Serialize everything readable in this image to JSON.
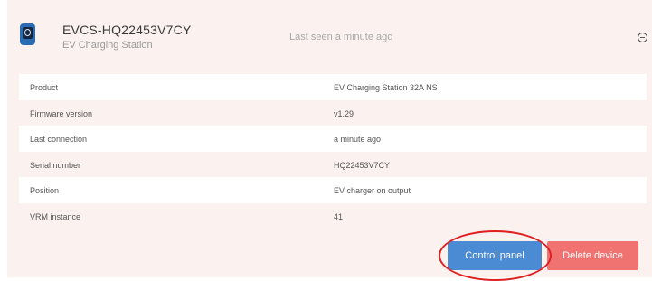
{
  "device": {
    "name": "EVCS-HQ22453V7CY",
    "type": "EV Charging Station",
    "last_seen": "Last seen a minute ago"
  },
  "details": [
    {
      "key": "Product",
      "value": "EV Charging Station 32A NS"
    },
    {
      "key": "Firmware version",
      "value": "v1.29"
    },
    {
      "key": "Last connection",
      "value": "a minute ago"
    },
    {
      "key": "Serial number",
      "value": "HQ22453V7CY"
    },
    {
      "key": "Position",
      "value": "EV charger on output"
    },
    {
      "key": "VRM instance",
      "value": "41"
    }
  ],
  "actions": {
    "control_panel": "Control panel",
    "delete_device": "Delete device"
  },
  "colors": {
    "card_bg": "#fbf1ee",
    "primary_button": "#4a8bd3",
    "danger_button": "#f07372",
    "highlight": "#e02020"
  },
  "icons": {
    "device": "ev-charger-icon",
    "collapse": "collapse-icon"
  }
}
